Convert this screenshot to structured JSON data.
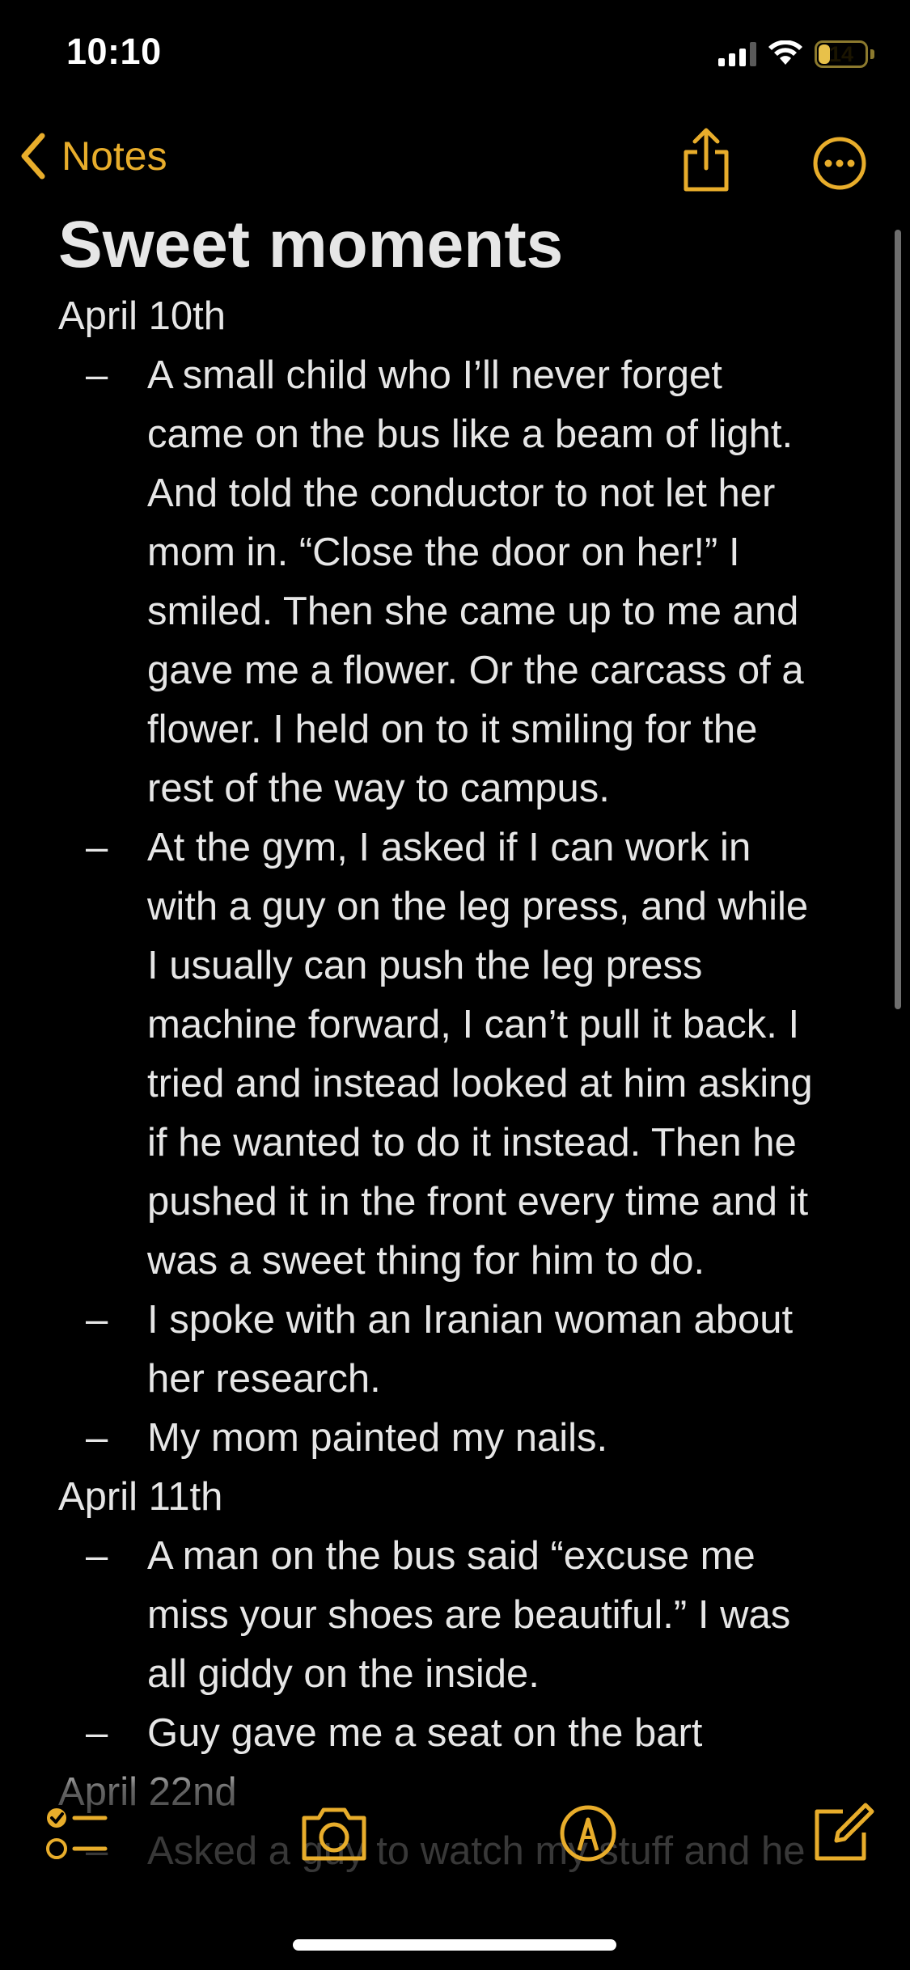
{
  "status_bar": {
    "time": "10:10",
    "battery_level": "14"
  },
  "nav": {
    "back_label": "Notes",
    "back_icon": "chevron-left-icon",
    "share_icon": "share-icon",
    "more_icon": "ellipsis-circle-icon"
  },
  "note": {
    "title": "Sweet moments",
    "sections": [
      {
        "date": "April 10th",
        "items": [
          "A small child who I’ll never forget came on the bus like a beam of light. And told the conductor to not let her mom in. “Close the door on her!” I smiled. Then she came up to me and gave me a flower. Or the carcass of a flower. I held on to it smiling for the rest of the way to campus.",
          "At the gym, I asked if I can work in with a guy on the leg press, and while I usually can push the leg press machine forward, I can’t pull it back. I tried and instead looked at him asking if he wanted to do it instead. Then he pushed it in the front every time and it was a sweet thing for him to do.",
          "I spoke with an Iranian woman about her research.",
          "My mom painted my nails."
        ]
      },
      {
        "date": "April 11th",
        "items": [
          "A man on the bus said “excuse me miss your shoes are beautiful.” I was all giddy on the inside.",
          "Guy gave me a seat on the bart"
        ]
      },
      {
        "date": "April 22nd",
        "items": [
          "Asked a guy to watch my stuff and he"
        ]
      }
    ],
    "dash": "–"
  },
  "toolbar": {
    "checklist_icon": "checklist-icon",
    "camera_icon": "camera-icon",
    "markup_icon": "markup-pen-icon",
    "compose_icon": "compose-icon"
  },
  "colors": {
    "accent": "#e8ad2b",
    "background": "#000000",
    "text": "#e6e6e6"
  }
}
